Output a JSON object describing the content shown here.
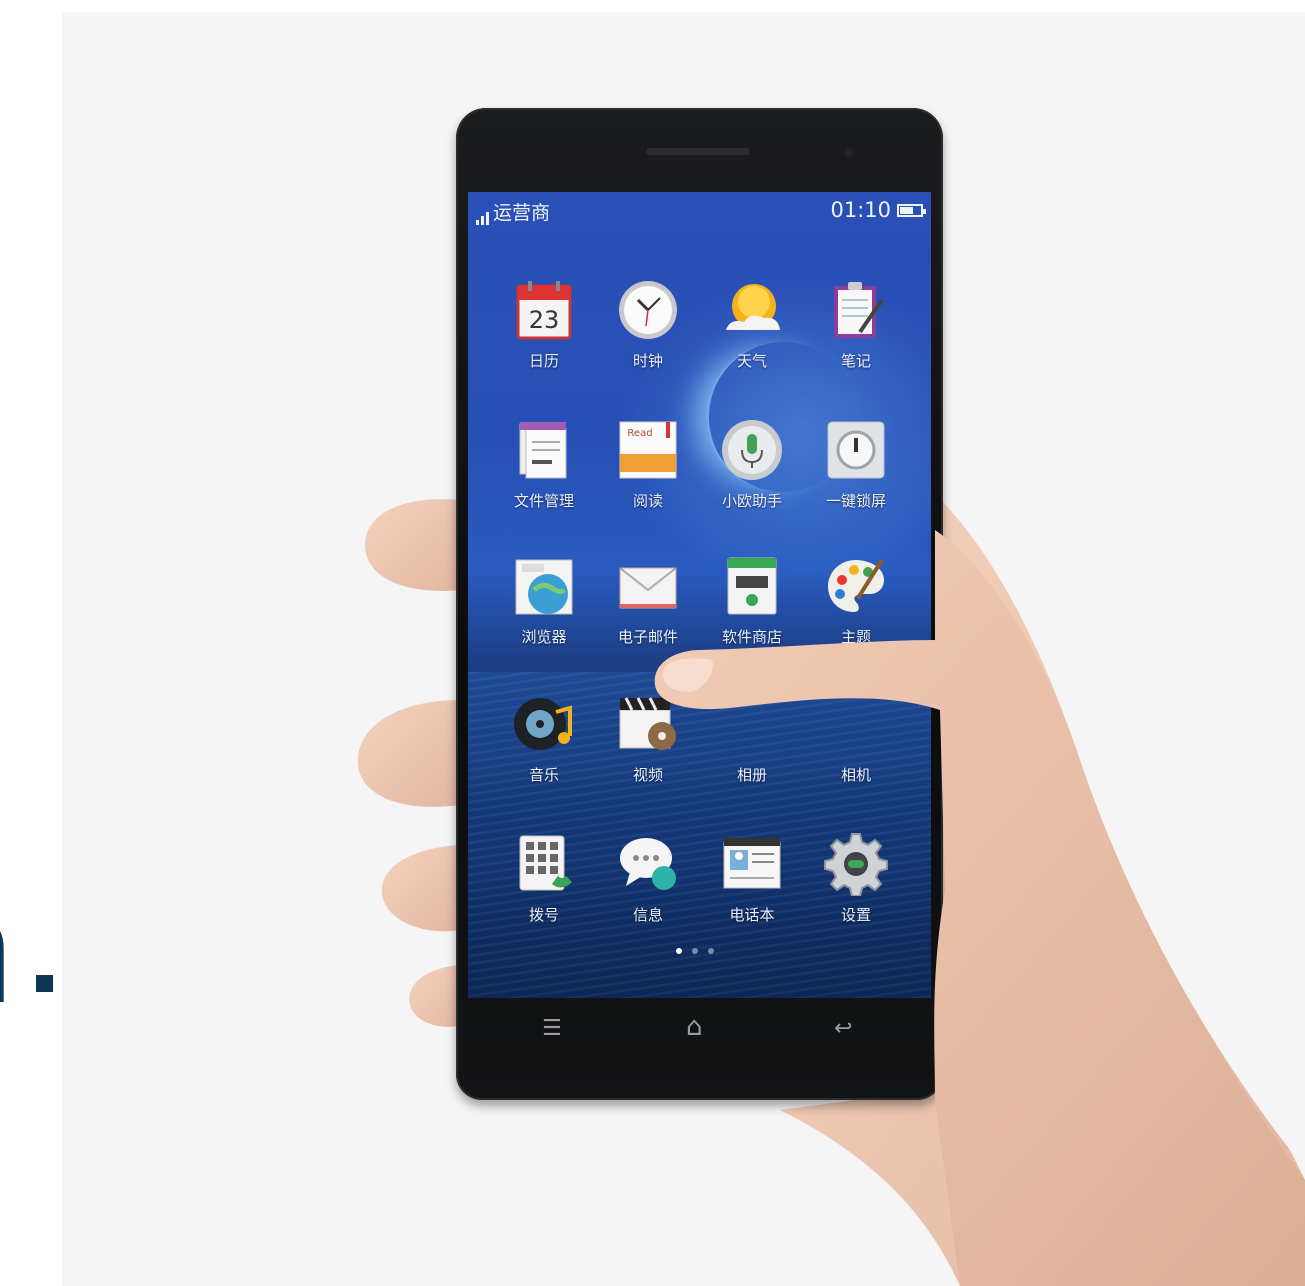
{
  "side_text": {
    "glyph": "n"
  },
  "status_bar": {
    "carrier": "运营商",
    "time": "01:10",
    "icons": [
      "signal-icon",
      "battery-icon"
    ]
  },
  "apps": [
    {
      "label": "日历",
      "icon": "calendar-icon",
      "badge": "23"
    },
    {
      "label": "时钟",
      "icon": "clock-icon"
    },
    {
      "label": "天气",
      "icon": "weather-icon"
    },
    {
      "label": "笔记",
      "icon": "notes-icon"
    },
    {
      "label": "文件管理",
      "icon": "file-manager-icon"
    },
    {
      "label": "阅读",
      "icon": "reader-icon",
      "badge": "Read"
    },
    {
      "label": "小欧助手",
      "icon": "voice-assistant-icon"
    },
    {
      "label": "一键锁屏",
      "icon": "lock-screen-icon"
    },
    {
      "label": "浏览器",
      "icon": "browser-icon"
    },
    {
      "label": "电子邮件",
      "icon": "email-icon"
    },
    {
      "label": "软件商店",
      "icon": "app-store-icon"
    },
    {
      "label": "主题",
      "icon": "palette-icon"
    },
    {
      "label": "音乐",
      "icon": "music-icon"
    },
    {
      "label": "视频",
      "icon": "video-icon"
    },
    {
      "label": "相册",
      "icon": "gallery-icon"
    },
    {
      "label": "相机",
      "icon": "camera-icon"
    },
    {
      "label": "拨号",
      "icon": "dialer-icon"
    },
    {
      "label": "信息",
      "icon": "messages-icon"
    },
    {
      "label": "电话本",
      "icon": "contacts-icon"
    },
    {
      "label": "设置",
      "icon": "settings-icon"
    }
  ],
  "page_indicator": {
    "pages": 3,
    "current": 1
  },
  "nav_bar": {
    "menu": "☰",
    "home": "⌂",
    "back": "↩"
  },
  "colors": {
    "wallpaper_top": "#2a4fb6",
    "sea": "#143a7c",
    "phone_body": "#111214",
    "side_text": "#0e3655"
  }
}
